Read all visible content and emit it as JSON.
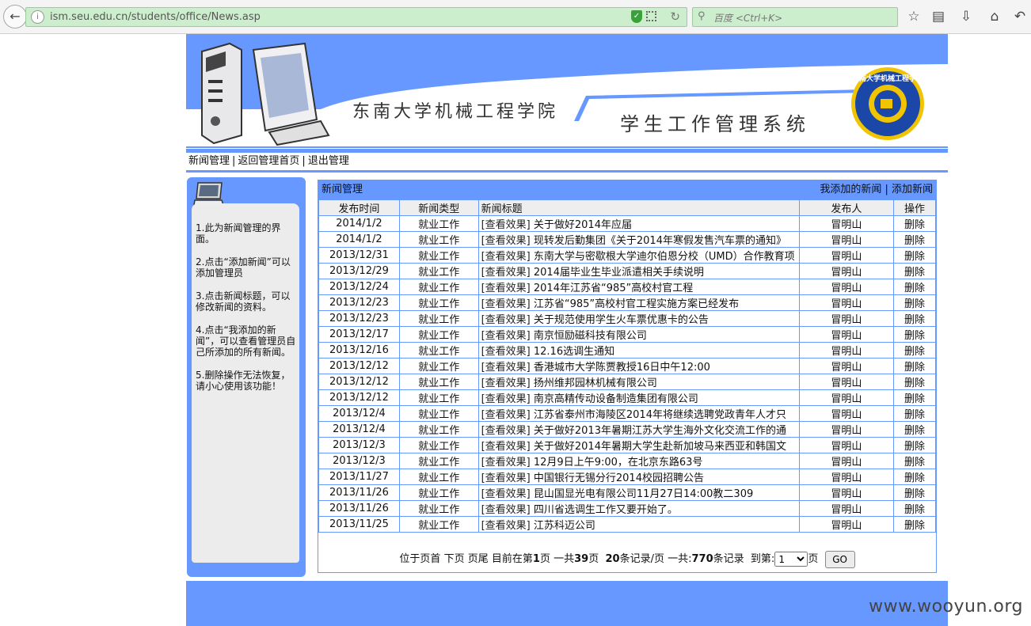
{
  "browser": {
    "url": "ism.seu.edu.cn/students/office/News.asp",
    "search_placeholder": "百度 <Ctrl+K>"
  },
  "banner": {
    "school_name": "东南大学机械工程学院",
    "system_name": "学生工作管理系统",
    "logo_text": "东南大学机械工程学院",
    "colors": {
      "frame": "#6698ff",
      "header_band": "#6698ff"
    }
  },
  "nav": {
    "items": [
      "新闻管理",
      "返回管理首页",
      "退出管理"
    ]
  },
  "help": {
    "items": [
      "1.此为新闻管理的界面。",
      "2.点击“添加新闻”可以添加管理员",
      "3.点击新闻标题，可以修改新闻的资料。",
      "4.点击“我添加的新闻”，可以查看管理员自己所添加的所有新闻。",
      "5.删除操作无法恢复，请小心使用该功能！"
    ]
  },
  "news": {
    "panel_title": "新闻管理",
    "my_news_link": "我添加的新闻",
    "add_news_link": "添加新闻",
    "columns": [
      "发布时间",
      "新闻类型",
      "新闻标题",
      "发布人",
      "操作"
    ],
    "rows": [
      {
        "date": "2014/1/2",
        "type": "就业工作",
        "view": "[查看效果]",
        "title": "关于做好2014年应届",
        "author": "冒明山",
        "op": "删除"
      },
      {
        "date": "2014/1/2",
        "type": "就业工作",
        "view": "[查看效果]",
        "title": "现转发后勤集团《关于2014年寒假发售汽车票的通知》",
        "author": "冒明山",
        "op": "删除"
      },
      {
        "date": "2013/12/31",
        "type": "就业工作",
        "view": "[查看效果]",
        "title": "东南大学与密歇根大学迪尔伯恩分校（UMD）合作教育项",
        "author": "冒明山",
        "op": "删除"
      },
      {
        "date": "2013/12/29",
        "type": "就业工作",
        "view": "[查看效果]",
        "title": "2014届毕业生毕业派遣相关手续说明",
        "author": "冒明山",
        "op": "删除"
      },
      {
        "date": "2013/12/24",
        "type": "就业工作",
        "view": "[查看效果]",
        "title": "2014年江苏省“985”高校村官工程",
        "author": "冒明山",
        "op": "删除"
      },
      {
        "date": "2013/12/23",
        "type": "就业工作",
        "view": "[查看效果]",
        "title": "江苏省“985”高校村官工程实施方案已经发布",
        "author": "冒明山",
        "op": "删除"
      },
      {
        "date": "2013/12/23",
        "type": "就业工作",
        "view": "[查看效果]",
        "title": "关于规范使用学生火车票优惠卡的公告",
        "author": "冒明山",
        "op": "删除"
      },
      {
        "date": "2013/12/17",
        "type": "就业工作",
        "view": "[查看效果]",
        "title": "南京恒励磁科技有限公司",
        "author": "冒明山",
        "op": "删除"
      },
      {
        "date": "2013/12/16",
        "type": "就业工作",
        "view": "[查看效果]",
        "title": "12.16选调生通知",
        "author": "冒明山",
        "op": "删除"
      },
      {
        "date": "2013/12/12",
        "type": "就业工作",
        "view": "[查看效果]",
        "title": "香港城市大学陈贾教授16日中午12:00",
        "author": "冒明山",
        "op": "删除"
      },
      {
        "date": "2013/12/12",
        "type": "就业工作",
        "view": "[查看效果]",
        "title": "扬州维邦园林机械有限公司",
        "author": "冒明山",
        "op": "删除"
      },
      {
        "date": "2013/12/12",
        "type": "就业工作",
        "view": "[查看效果]",
        "title": "南京高精传动设备制造集团有限公司",
        "author": "冒明山",
        "op": "删除"
      },
      {
        "date": "2013/12/4",
        "type": "就业工作",
        "view": "[查看效果]",
        "title": "江苏省泰州市海陵区2014年将继续选聘党政青年人才只",
        "author": "冒明山",
        "op": "删除"
      },
      {
        "date": "2013/12/4",
        "type": "就业工作",
        "view": "[查看效果]",
        "title": "关于做好2013年暑期江苏大学生海外文化交流工作的通",
        "author": "冒明山",
        "op": "删除"
      },
      {
        "date": "2013/12/3",
        "type": "就业工作",
        "view": "[查看效果]",
        "title": "关于做好2014年暑期大学生赴新加坡马来西亚和韩国文",
        "author": "冒明山",
        "op": "删除"
      },
      {
        "date": "2013/12/3",
        "type": "就业工作",
        "view": "[查看效果]",
        "title": "12月9日上午9:00，在北京东路63号",
        "author": "冒明山",
        "op": "删除"
      },
      {
        "date": "2013/11/27",
        "type": "就业工作",
        "view": "[查看效果]",
        "title": "中国银行无锡分行2014校园招聘公告",
        "author": "冒明山",
        "op": "删除"
      },
      {
        "date": "2013/11/26",
        "type": "就业工作",
        "view": "[查看效果]",
        "title": "昆山国显光电有限公司11月27日14:00教二309",
        "author": "冒明山",
        "op": "删除"
      },
      {
        "date": "2013/11/26",
        "type": "就业工作",
        "view": "[查看效果]",
        "title": "四川省选调生工作又要开始了。",
        "author": "冒明山",
        "op": "删除"
      },
      {
        "date": "2013/11/25",
        "type": "就业工作",
        "view": "[查看效果]",
        "title": "江苏科迈公司",
        "author": "冒明山",
        "op": "删除"
      }
    ]
  },
  "pager": {
    "text_at": "位于页首",
    "next": "下页",
    "last": "页尾",
    "current_prefix": "目前在第",
    "current_page": "1",
    "page_unit": "页",
    "total_prefix": "一共",
    "total_pages": "39",
    "total_suffix": "页",
    "per_page": "20",
    "per_page_suffix": "条记录/页",
    "total_records_prefix": "一共:",
    "total_records": "770",
    "total_records_suffix": "条记录",
    "goto_label": "到第:",
    "goto_value": "1",
    "goto_suffix": "页",
    "go_button": "GO"
  },
  "watermark": "www.wooyun.org"
}
